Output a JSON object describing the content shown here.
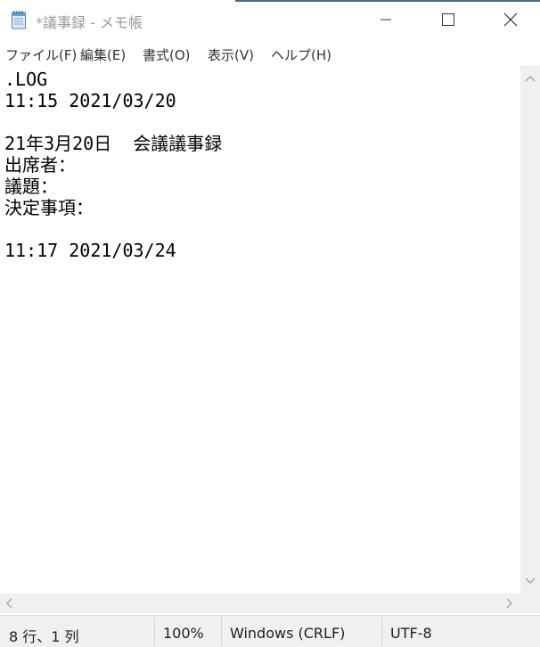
{
  "window": {
    "title": "*議事録 - メモ帳",
    "accent_color": "#4a6a8c"
  },
  "titlebar_buttons": {
    "minimize_icon": "minimize-icon",
    "maximize_icon": "maximize-icon",
    "close_icon": "close-icon"
  },
  "menu": {
    "items": [
      {
        "label": "ファイル(F)"
      },
      {
        "label": "編集(E)"
      },
      {
        "label": "書式(O)"
      },
      {
        "label": "表示(V)"
      },
      {
        "label": "ヘルプ(H)"
      }
    ]
  },
  "editor": {
    "lines": [
      ".LOG",
      "11:15 2021/03/20",
      "",
      "21年3月20日  会議議事録",
      "出席者：",
      "議題：",
      "決定事項：",
      "",
      "11:17 2021/03/24"
    ]
  },
  "status": {
    "position": "8 行、1 列",
    "zoom": "100%",
    "line_ending": "Windows (CRLF)",
    "encoding": "UTF-8"
  }
}
